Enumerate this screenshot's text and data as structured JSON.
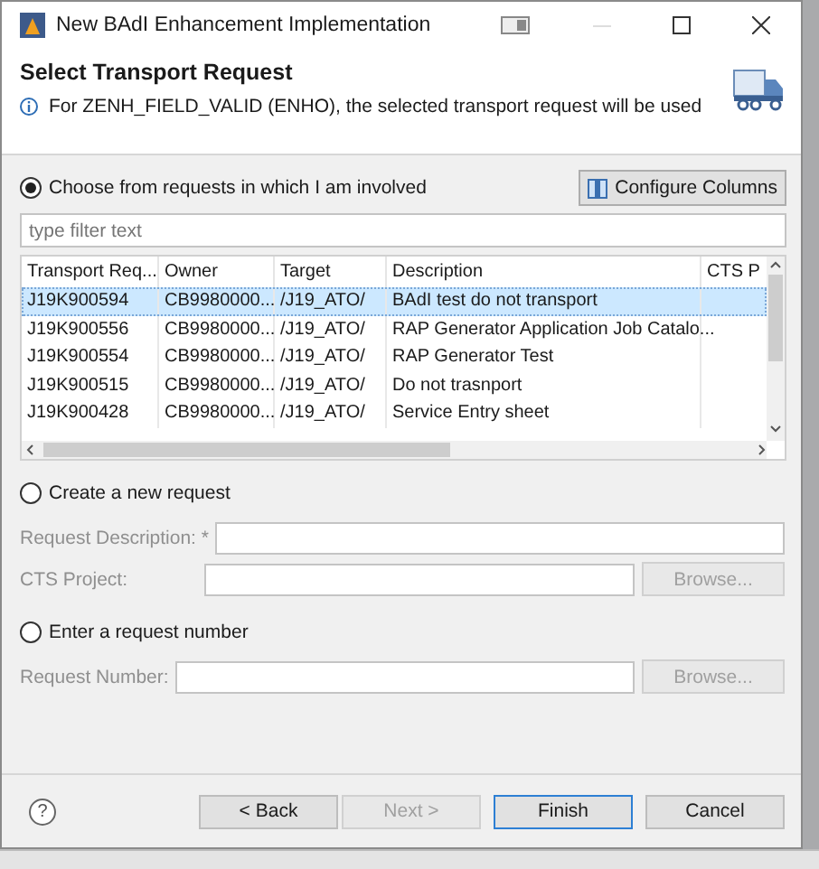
{
  "window": {
    "title": "New BAdI Enhancement Implementation"
  },
  "header": {
    "title": "Select Transport Request",
    "message": "For ZENH_FIELD_VALID (ENHO), the selected transport request will be used"
  },
  "choose_section": {
    "radio": {
      "label": "Choose from requests in which I am involved",
      "selected": true
    },
    "configure_button": "Configure Columns",
    "filter": {
      "placeholder": "type filter text"
    },
    "table": {
      "columns": [
        "Transport Req...",
        "Owner",
        "Target",
        "Description",
        "CTS P"
      ],
      "rows": [
        {
          "cells": [
            "J19K900594",
            "CB9980000...",
            "/J19_ATO/",
            "BAdI test do not transport"
          ],
          "selected": true
        },
        {
          "cells": [
            "J19K900556",
            "CB9980000...",
            "/J19_ATO/",
            "RAP Generator Application Job Catalo..."
          ],
          "selected": false
        },
        {
          "cells": [
            "J19K900554",
            "CB9980000...",
            "/J19_ATO/",
            "RAP Generator Test"
          ],
          "selected": false
        },
        {
          "cells": [
            "J19K900515",
            "CB9980000...",
            "/J19_ATO/",
            "Do not trasnport"
          ],
          "selected": false
        },
        {
          "cells": [
            "J19K900428",
            "CB9980000...",
            "/J19_ATO/",
            "Service Entry sheet"
          ],
          "selected": false
        }
      ]
    }
  },
  "create_section": {
    "radio": {
      "label": "Create a new request",
      "selected": false
    },
    "fields": [
      {
        "label": "Request Description: *",
        "disabled": true
      },
      {
        "label": "CTS Project:",
        "disabled": true,
        "browse": "Browse..."
      }
    ]
  },
  "number_section": {
    "radio": {
      "label": "Enter a request number",
      "selected": false
    },
    "fields": [
      {
        "label": "Request Number:",
        "disabled": true,
        "browse": "Browse..."
      }
    ]
  },
  "help": "?",
  "buttons": [
    {
      "label": "< Back",
      "disabled": false,
      "default": false
    },
    {
      "label": "Next >",
      "disabled": true,
      "default": false
    },
    {
      "label": "Finish",
      "disabled": false,
      "default": true
    },
    {
      "label": "Cancel",
      "disabled": false,
      "default": false
    }
  ]
}
